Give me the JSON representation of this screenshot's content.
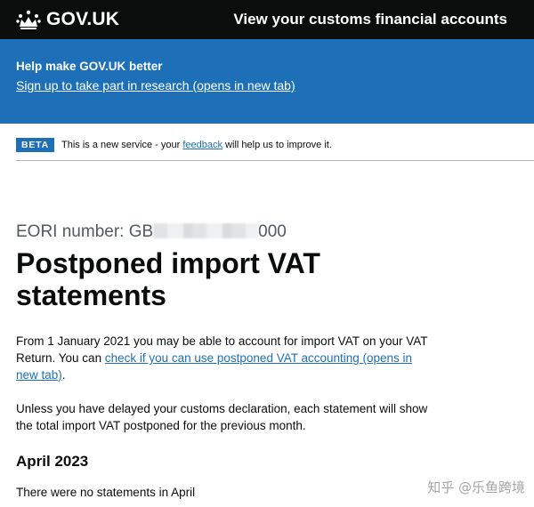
{
  "header": {
    "logo_text": "GOV.UK",
    "service_name": "View your customs financial accounts"
  },
  "banner": {
    "title": "Help make GOV.UK better",
    "link": "Sign up to take part in research (opens in new tab)"
  },
  "phase": {
    "tag": "BETA",
    "text_before": "This is a new service - your ",
    "feedback_link": "feedback",
    "text_after": " will help us to improve it."
  },
  "main": {
    "eori_prefix": "EORI number: GB",
    "eori_suffix": "000",
    "title": "Postponed import VAT statements",
    "para1_text": "From 1 January 2021 you may be able to account for import VAT on your VAT Return. You can ",
    "para1_link": "check if you can use postponed VAT accounting (opens in new tab)",
    "para1_end": ".",
    "para2": "Unless you have delayed your customs declaration, each statement will show the total import VAT postponed for the previous month.",
    "month_heading": "April 2023",
    "no_statements": "There were no statements in April"
  },
  "watermark": "知乎 @乐鱼跨境",
  "colors": {
    "header_bg": "#0b0c0c",
    "banner_bg": "#1d70b8",
    "link": "#1d70b8",
    "tag_bg": "#1d70b8"
  }
}
